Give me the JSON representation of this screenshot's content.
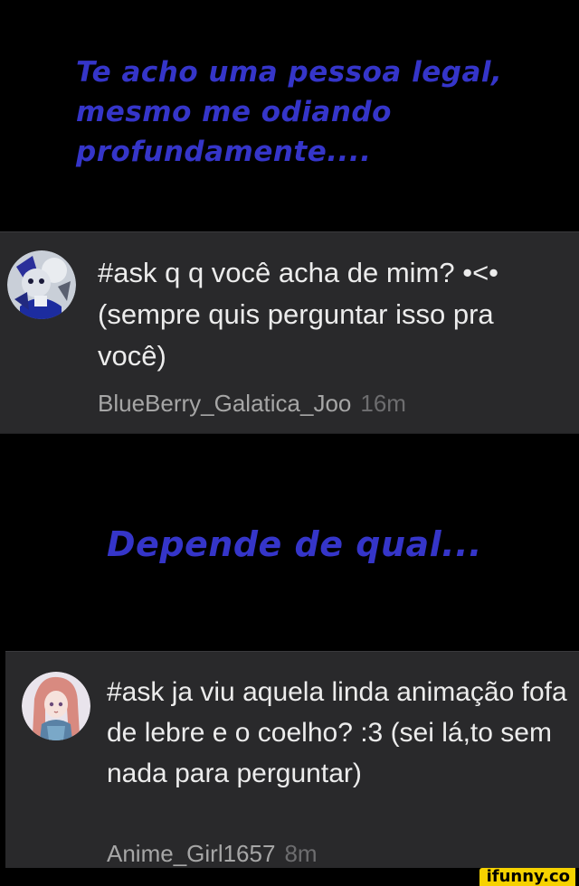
{
  "answers": [
    "Te acho uma pessoa legal, mesmo me odiando profundamente....",
    "Depende de qual..."
  ],
  "cards": [
    {
      "question": "#ask q q você acha de mim? •<• (sempre quis perguntar isso pra você)",
      "username": "BlueBerry_Galatica_Joo",
      "time": "16m",
      "avatar_icon": "blue-character-avatar-icon"
    },
    {
      "question": "#ask ja viu aquela linda animação fofa de lebre e o coelho? :3 (sei lá,to sem nada para perguntar)",
      "username": "Anime_Girl1657",
      "time": "8m",
      "avatar_icon": "anime-girl-avatar-icon"
    }
  ],
  "watermark": "ifunny.co",
  "colors": {
    "background": "#000000",
    "answer_text": "#3535c9",
    "card_background": "#29292b",
    "question_text": "#ececec",
    "username_text": "#a6a6a6",
    "time_text": "#6d6d6f",
    "watermark_background": "#f6d200"
  }
}
